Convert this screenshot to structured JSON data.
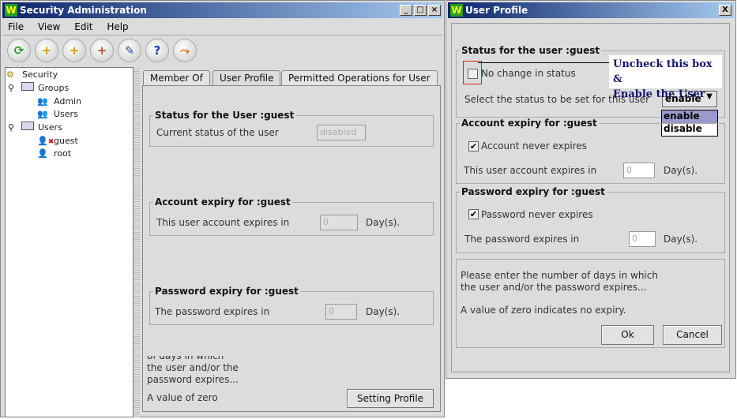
{
  "main_window": {
    "title": "Security Administration",
    "menu": [
      "File",
      "View",
      "Edit",
      "Help"
    ],
    "toolbar": [
      {
        "icon": "refresh-icon",
        "glyph": "⟳",
        "color": "#2a9d2a"
      },
      {
        "icon": "add-user-icon",
        "glyph": "+",
        "color": "#d4a000"
      },
      {
        "icon": "add-group-icon",
        "glyph": "+",
        "color": "#d4a000"
      },
      {
        "icon": "add-operation-icon",
        "glyph": "+",
        "color": "#c05030"
      },
      {
        "icon": "edit-icon",
        "glyph": "✎",
        "color": "#2050a0"
      },
      {
        "icon": "help-icon",
        "glyph": "?",
        "color": "#1a3fa0"
      },
      {
        "icon": "exit-icon",
        "glyph": "🏃",
        "color": "#e07010"
      }
    ],
    "tree": {
      "root": "Security",
      "groups_label": "Groups",
      "groups": [
        "Admin",
        "Users"
      ],
      "users_label": "Users",
      "users": [
        "guest",
        "root"
      ]
    },
    "tabs": [
      "Member Of",
      "User Profile",
      "Permitted Operations for User"
    ],
    "active_tab": 1,
    "status": {
      "legend": "Status for the User :guest",
      "label": "Current status of the user",
      "value": "disabled"
    },
    "account": {
      "legend": "Account expiry for :guest",
      "label": "This user account expires in",
      "value": "0",
      "unit": "Day(s)."
    },
    "password": {
      "legend": "Password expiry for :guest",
      "label": "The password expires in",
      "value": "0",
      "unit": "Day(s)."
    },
    "info_lines": [
      "of days in which",
      "the user and/or the",
      "password expires...",
      "A value of zero"
    ],
    "setting_profile_button": "Setting Profile"
  },
  "dialog": {
    "title": "User Profile",
    "close": "X",
    "status": {
      "legend": "Status for the user :guest",
      "no_change_label": "No change in status",
      "no_change_checked": false,
      "select_label": "Select the status to be set for this user",
      "selected": "enable",
      "options": [
        "enable",
        "disable"
      ]
    },
    "annotation": [
      "Uncheck this box &",
      "Enable the User"
    ],
    "account": {
      "legend": "Account expiry for :guest",
      "checkbox": "Account never expires",
      "checked": true,
      "label": "This user account expires in",
      "value": "0",
      "unit": "Day(s)."
    },
    "password": {
      "legend": "Password expiry for :guest",
      "checkbox": "Password never expires",
      "checked": true,
      "label": "The password expires in",
      "value": "0",
      "unit": "Day(s)."
    },
    "info": [
      "Please enter the number of days in which",
      "the user and/or the password expires...",
      "A value of zero indicates no expiry."
    ],
    "ok": "Ok",
    "cancel": "Cancel"
  }
}
